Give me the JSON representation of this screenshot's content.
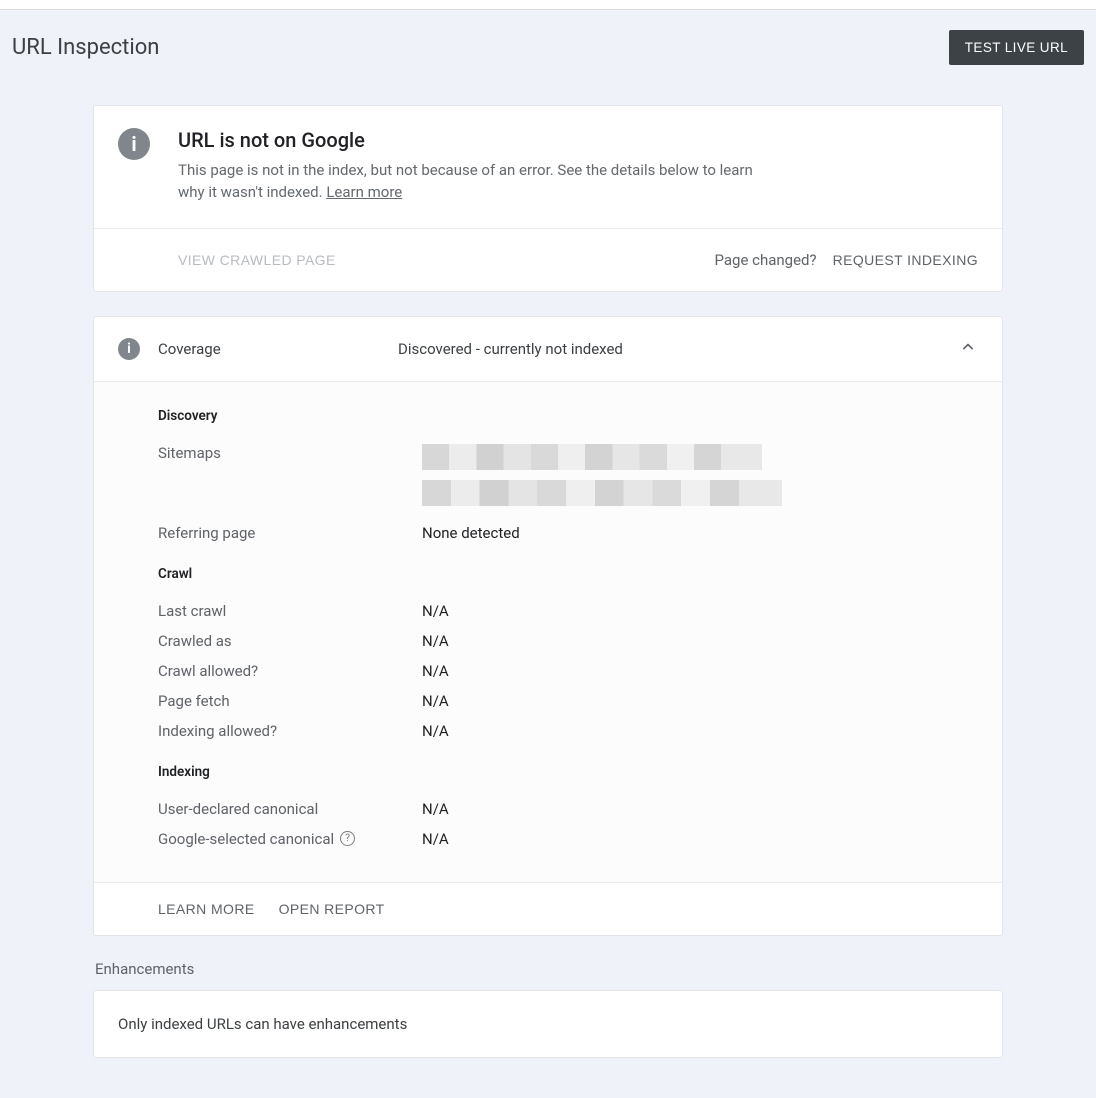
{
  "header": {
    "title": "URL Inspection",
    "test_live_url": "TEST LIVE URL"
  },
  "status_card": {
    "title": "URL is not on Google",
    "desc": "This page is not in the index, but not because of an error. See the details below to learn why it wasn't indexed.",
    "learn_more": "Learn more",
    "view_crawled": "VIEW CRAWLED PAGE",
    "page_changed": "Page changed?",
    "request_indexing": "REQUEST INDEXING"
  },
  "coverage": {
    "label": "Coverage",
    "value": "Discovered - currently not indexed",
    "sections": {
      "discovery": {
        "heading": "Discovery",
        "sitemaps_label": "Sitemaps",
        "referring_label": "Referring page",
        "referring_value": "None detected"
      },
      "crawl": {
        "heading": "Crawl",
        "rows": [
          {
            "label": "Last crawl",
            "value": "N/A"
          },
          {
            "label": "Crawled as",
            "value": "N/A"
          },
          {
            "label": "Crawl allowed?",
            "value": "N/A"
          },
          {
            "label": "Page fetch",
            "value": "N/A"
          },
          {
            "label": "Indexing allowed?",
            "value": "N/A"
          }
        ]
      },
      "indexing": {
        "heading": "Indexing",
        "rows": [
          {
            "label": "User-declared canonical",
            "value": "N/A"
          },
          {
            "label": "Google-selected canonical",
            "value": "N/A",
            "help": true
          }
        ]
      }
    },
    "footer": {
      "learn_more": "LEARN MORE",
      "open_report": "OPEN REPORT"
    }
  },
  "enhancements": {
    "label": "Enhancements",
    "message": "Only indexed URLs can have enhancements"
  }
}
